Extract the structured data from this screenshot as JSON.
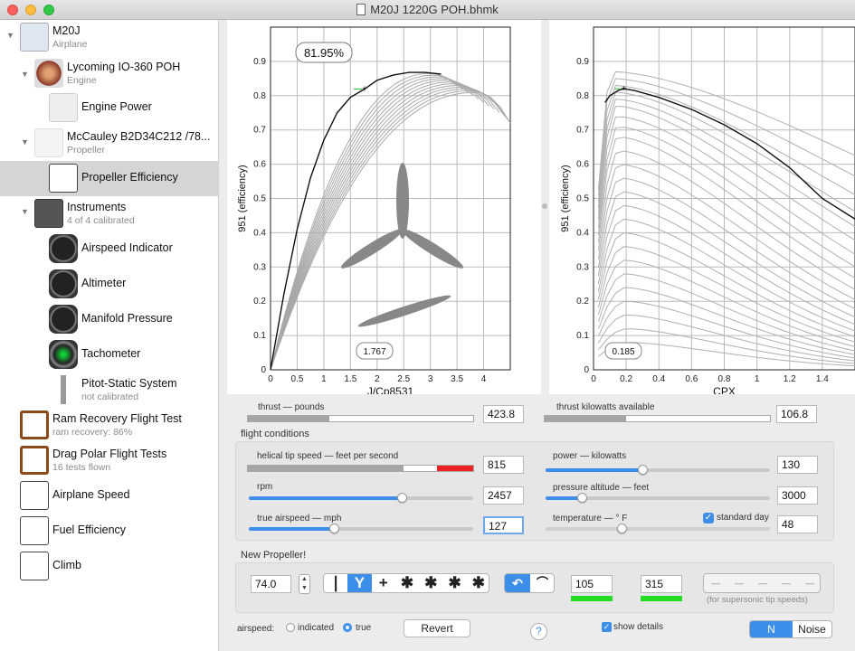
{
  "window": {
    "title": "M20J 1220G POH.bhmk"
  },
  "colors": {
    "accent": "#3d8ee8",
    "good": "#22dd22",
    "danger": "#ee2222"
  },
  "sidebar": {
    "items": [
      {
        "title": "M20J",
        "subtitle": "Airplane",
        "icon": "airplane-icon"
      },
      {
        "title": "Lycoming IO-360 POH",
        "subtitle": "Engine",
        "icon": "engine-icon"
      },
      {
        "title": "Engine Power",
        "subtitle": "",
        "icon": "engine-power-icon"
      },
      {
        "title": "McCauley B2D34C212 /78...",
        "subtitle": "Propeller",
        "icon": "propeller-icon"
      },
      {
        "title": "Propeller Efficiency",
        "subtitle": "",
        "icon": "efficiency-curve-icon"
      },
      {
        "title": "Instruments",
        "subtitle": "4 of 4 calibrated",
        "icon": "instrument-panel-icon"
      },
      {
        "title": "Airspeed Indicator",
        "subtitle": "",
        "icon": "airspeed-gauge-icon"
      },
      {
        "title": "Altimeter",
        "subtitle": "",
        "icon": "altimeter-gauge-icon"
      },
      {
        "title": "Manifold Pressure",
        "subtitle": "",
        "icon": "manifold-gauge-icon"
      },
      {
        "title": "Tachometer",
        "subtitle": "",
        "icon": "tachometer-gauge-icon"
      },
      {
        "title": "Pitot-Static System",
        "subtitle": "not calibrated",
        "icon": "pitot-static-icon"
      },
      {
        "title": "Ram Recovery Flight Test",
        "subtitle": "ram recovery: 86%",
        "icon": "clipboard-icon"
      },
      {
        "title": "Drag Polar Flight Tests",
        "subtitle": "16 tests flown",
        "icon": "clipboard-icon"
      },
      {
        "title": "Airplane Speed",
        "subtitle": "",
        "icon": "speed-curve-icon"
      },
      {
        "title": "Fuel Efficiency",
        "subtitle": "",
        "icon": "fuel-curve-icon"
      },
      {
        "title": "Climb",
        "subtitle": "",
        "icon": "climb-curve-icon"
      }
    ]
  },
  "chart_data": [
    {
      "type": "line",
      "xlabel": "J/Cp8531",
      "ylabel": "951 (efficiency)",
      "xlim": [
        0,
        4.5
      ],
      "ylim": [
        0,
        1.0
      ],
      "xticks": [
        "0",
        "0.5",
        "1",
        "1.5",
        "2",
        "2.5",
        "3",
        "3.5",
        "4"
      ],
      "yticks": [
        "0",
        "0.1",
        "0.2",
        "0.3",
        "0.4",
        "0.5",
        "0.6",
        "0.7",
        "0.8",
        "0.9"
      ],
      "badge": "81.95%",
      "cursor_x_label": "1.767",
      "marker": {
        "x": 1.767,
        "y": 0.8195
      },
      "series": [
        {
          "values": [
            [
              0,
              0
            ],
            [
              0.25,
              0.22
            ],
            [
              0.5,
              0.41
            ],
            [
              0.75,
              0.56
            ],
            [
              1.0,
              0.67
            ],
            [
              1.25,
              0.75
            ],
            [
              1.5,
              0.795
            ],
            [
              1.767,
              0.8195
            ],
            [
              2.0,
              0.845
            ],
            [
              2.3,
              0.86
            ],
            [
              2.6,
              0.868
            ],
            [
              2.9,
              0.868
            ],
            [
              3.2,
              0.863
            ]
          ]
        }
      ],
      "family": [
        {
          "peak_x": 3.0,
          "peak_y": 0.865,
          "end_x": 3.5,
          "end_y": 0.83
        },
        {
          "peak_x": 3.08,
          "peak_y": 0.86,
          "end_x": 3.6,
          "end_y": 0.82
        },
        {
          "peak_x": 3.16,
          "peak_y": 0.855,
          "end_x": 3.7,
          "end_y": 0.81
        },
        {
          "peak_x": 3.24,
          "peak_y": 0.85,
          "end_x": 3.8,
          "end_y": 0.8
        },
        {
          "peak_x": 3.32,
          "peak_y": 0.845,
          "end_x": 3.9,
          "end_y": 0.79
        },
        {
          "peak_x": 3.4,
          "peak_y": 0.84,
          "end_x": 4.0,
          "end_y": 0.78
        },
        {
          "peak_x": 3.48,
          "peak_y": 0.835,
          "end_x": 4.1,
          "end_y": 0.77
        },
        {
          "peak_x": 3.56,
          "peak_y": 0.83,
          "end_x": 4.2,
          "end_y": 0.76
        },
        {
          "peak_x": 3.64,
          "peak_y": 0.825,
          "end_x": 4.3,
          "end_y": 0.75
        },
        {
          "peak_x": 3.72,
          "peak_y": 0.82,
          "end_x": 4.4,
          "end_y": 0.74
        },
        {
          "peak_x": 3.8,
          "peak_y": 0.815,
          "end_x": 4.45,
          "end_y": 0.73
        },
        {
          "peak_x": 3.88,
          "peak_y": 0.81,
          "end_x": 4.5,
          "end_y": 0.72
        }
      ]
    },
    {
      "type": "line",
      "xlabel": "CPX",
      "ylabel": "951 (efficiency)",
      "xlim": [
        0,
        1.6
      ],
      "ylim": [
        0,
        1.0
      ],
      "xticks": [
        "0",
        "0.2",
        "0.4",
        "0.6",
        "0.8",
        "1",
        "1.2",
        "1.4"
      ],
      "yticks": [
        "0",
        "0.1",
        "0.2",
        "0.3",
        "0.4",
        "0.5",
        "0.6",
        "0.7",
        "0.8",
        "0.9"
      ],
      "cursor_x_label": "0.185",
      "marker": {
        "x": 0.185,
        "y": 0.82
      },
      "series": [
        {
          "values": [
            [
              0.07,
              0.78
            ],
            [
              0.1,
              0.8
            ],
            [
              0.15,
              0.815
            ],
            [
              0.185,
              0.82
            ],
            [
              0.25,
              0.815
            ],
            [
              0.4,
              0.795
            ],
            [
              0.6,
              0.76
            ],
            [
              0.8,
              0.715
            ],
            [
              1.0,
              0.66
            ],
            [
              1.2,
              0.59
            ],
            [
              1.4,
              0.5
            ],
            [
              1.6,
              0.44
            ]
          ]
        }
      ],
      "family_peaks": [
        0.87,
        0.85,
        0.83,
        0.81,
        0.79,
        0.77,
        0.74,
        0.71,
        0.68,
        0.64,
        0.6,
        0.56,
        0.52,
        0.48,
        0.44,
        0.4,
        0.36,
        0.32,
        0.28,
        0.24,
        0.2,
        0.16,
        0.12,
        0.08
      ]
    }
  ],
  "bars": {
    "thrust_label": "thrust — pounds",
    "thrust_value": "423.8",
    "thrust_fraction": 0.36,
    "kw_label": "thrust kilowatts available",
    "kw_value": "106.8",
    "kw_fraction": 0.36
  },
  "flight": {
    "section_label": "flight conditions",
    "tip_label": "helical tip speed — feet per second",
    "tip_value": "815",
    "rpm_label": "rpm",
    "rpm_value": "2457",
    "rpm_fraction": 0.68,
    "tas_label": "true airspeed — mph",
    "tas_value": "127",
    "tas_fraction": 0.38,
    "power_label": "power — kilowatts",
    "power_value": "130",
    "power_fraction": 0.43,
    "alt_label": "pressure altitude — feet",
    "alt_value": "3000",
    "alt_fraction": 0.16,
    "temp_label": "temperature — ° F",
    "temp_value": "48",
    "temp_fraction": 0.34,
    "std_day_label": "standard day"
  },
  "propeller": {
    "section_label": "New Propeller!",
    "diameter_value": "74.0",
    "blade_counts": [
      "1",
      "3",
      "4",
      "5",
      "6",
      "7",
      "8"
    ],
    "field_a": "105",
    "field_b": "315",
    "supersonic_label": "(for supersonic tip speeds)"
  },
  "footer": {
    "airspeed_label": "airspeed:",
    "indicated_label": "indicated",
    "true_label": "true",
    "revert_label": "Revert",
    "help_label": "?",
    "show_details_label": "show details",
    "n_label": "N",
    "noise_label": "Noise"
  }
}
